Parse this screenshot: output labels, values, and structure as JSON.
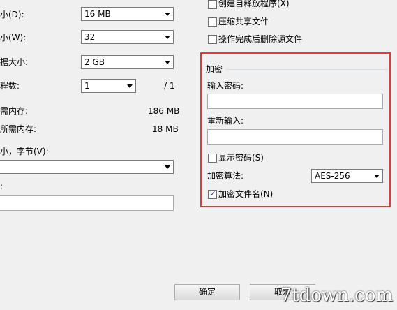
{
  "left": {
    "dict_label": "小(D):",
    "dict_value": "16 MB",
    "word_label": "小(W):",
    "word_value": "32",
    "solid_label": "据大小:",
    "solid_value": "2 GB",
    "threads_label": "程数:",
    "threads_value": "1",
    "threads_total": "/ 1",
    "mem_compress_label": "需内存:",
    "mem_compress_value": "186 MB",
    "mem_decompress_label": "所需内存:",
    "mem_decompress_value": "18 MB",
    "volume_label": "小，字节(V):",
    "param_label": ":"
  },
  "options": {
    "sfx_label": "创建自释放程序(X)",
    "share_label": "压缩共享文件",
    "delete_label": "操作完成后删除源文件"
  },
  "encryption": {
    "group_title": "加密",
    "password_label": "输入密码:",
    "reenter_label": "重新输入:",
    "show_password_label": "显示密码(S)",
    "method_label": "加密算法:",
    "method_value": "AES-256",
    "encrypt_names_label": "加密文件名(N)",
    "encrypt_names_checked": true,
    "highlight_color": "#e0393e"
  },
  "buttons": {
    "ok_label": "确定",
    "cancel_label": "取消"
  },
  "watermark": "7tdown.com"
}
